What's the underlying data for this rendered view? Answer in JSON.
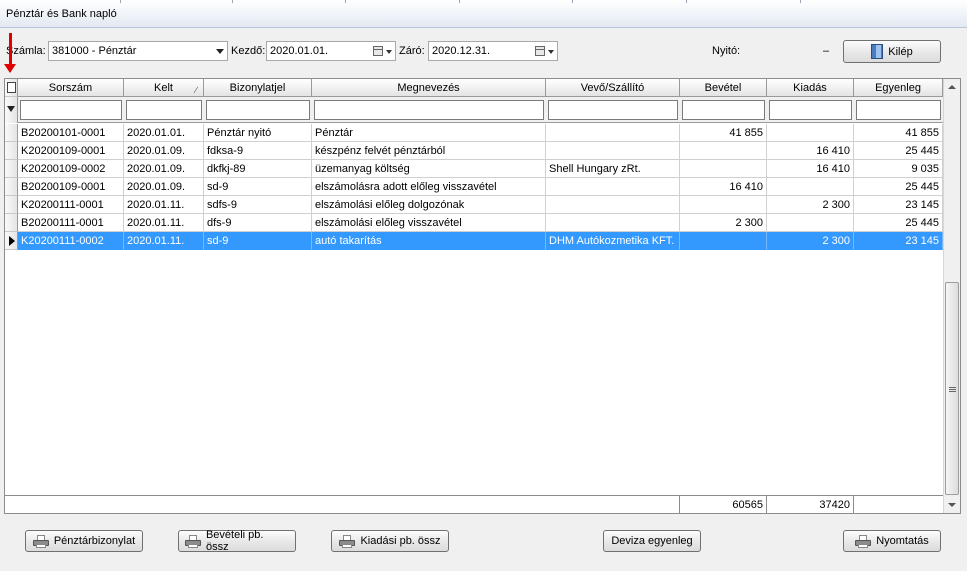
{
  "window": {
    "title": "Pénztár és Bank napló"
  },
  "toolbar": {
    "szamla_label": "Számla:",
    "szamla_value": "381000 - Pénztár",
    "kezdo_label": "Kezdő:",
    "kezdo_value": "2020.01.01.",
    "zaro_label": "Záró:",
    "zaro_value": "2020.12.31.",
    "nyito_label": "Nyitó:",
    "nyito_value": "–",
    "kilep_label": "Kilép"
  },
  "grid": {
    "columns": [
      "Sorszám",
      "Kelt",
      "Bizonylatjel",
      "Megnevezés",
      "Vevő/Szállító",
      "Bevétel",
      "Kiadás",
      "Egyenleg"
    ],
    "rows": [
      [
        "B20200101-0001",
        "2020.01.01.",
        "Pénztár nyitó",
        "Pénztár",
        "",
        "41 855",
        "",
        "41 855"
      ],
      [
        "K20200109-0001",
        "2020.01.09.",
        "fdksa-9",
        "készpénz felvét pénztárból",
        "",
        "",
        "16 410",
        "25 445"
      ],
      [
        "K20200109-0002",
        "2020.01.09.",
        "dkfkj-89",
        "üzemanyag költség",
        "Shell Hungary zRt.",
        "",
        "16 410",
        "9 035"
      ],
      [
        "B20200109-0001",
        "2020.01.09.",
        "sd-9",
        "elszámolásra adott előleg visszavétel",
        "",
        "16 410",
        "",
        "25 445"
      ],
      [
        "K20200111-0001",
        "2020.01.11.",
        "sdfs-9",
        "elszámolási előleg dolgozónak",
        "",
        "",
        "2 300",
        "23 145"
      ],
      [
        "B20200111-0001",
        "2020.01.11.",
        "dfs-9",
        "elszámolási előleg visszavétel",
        "",
        "2 300",
        "",
        "25 445"
      ],
      [
        "K20200111-0002",
        "2020.01.11.",
        "sd-9",
        "autó takarítás",
        "DHM Autókozmetika KFT.",
        "",
        "2 300",
        "23 145"
      ]
    ],
    "selected_row": 6,
    "totals": {
      "bevetel": "60565",
      "kiadas": "37420"
    }
  },
  "bottom": {
    "penztarbizonylat": "Pénztárbizonylat",
    "beveteli": "Bevételi pb. össz",
    "kiadasi": "Kiadási pb. össz",
    "deviza": "Deviza egyenleg",
    "nyomtatas": "Nyomtatás"
  },
  "colors": {
    "selection": "#3399ff",
    "annotation_arrow": "#e00000"
  }
}
